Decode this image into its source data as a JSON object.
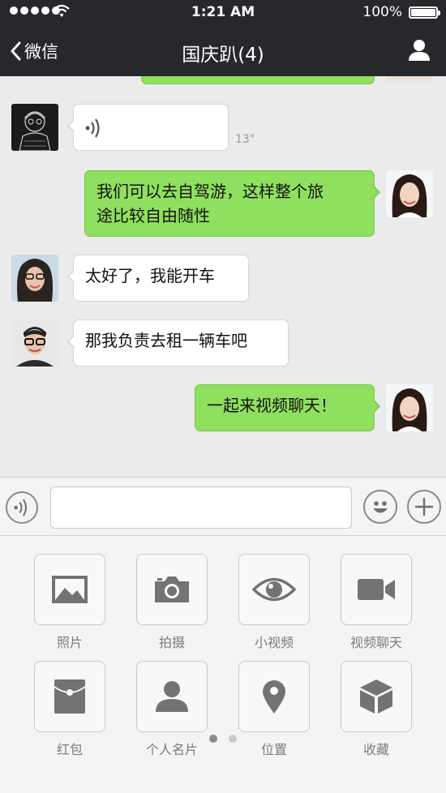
{
  "status_bar": {
    "time": "1:21 AM",
    "battery": "100%"
  },
  "nav": {
    "back_label": "微信",
    "title": "国庆趴(4)"
  },
  "messages": [
    {
      "side": "left",
      "type": "voice",
      "duration": "13\""
    },
    {
      "side": "right",
      "type": "text",
      "text_line1": "我们可以去自驾游，这样整个旅",
      "text_line2": "途比较自由随性"
    },
    {
      "side": "left",
      "type": "text",
      "text": "太好了，我能开车"
    },
    {
      "side": "left",
      "type": "text",
      "text": "那我负责去租一辆车吧"
    },
    {
      "side": "right",
      "type": "text",
      "text": "一起来视频聊天！"
    }
  ],
  "panel": {
    "items": [
      {
        "label": "照片",
        "icon": "photo-icon"
      },
      {
        "label": "拍摄",
        "icon": "camera-icon"
      },
      {
        "label": "小视频",
        "icon": "eye-icon"
      },
      {
        "label": "视频聊天",
        "icon": "video-camera-icon"
      },
      {
        "label": "红包",
        "icon": "red-envelope-icon"
      },
      {
        "label": "个人名片",
        "icon": "person-icon"
      },
      {
        "label": "位置",
        "icon": "location-pin-icon"
      },
      {
        "label": "收藏",
        "icon": "box-icon"
      }
    ],
    "page_count": 2,
    "active_page": 1
  },
  "colors": {
    "nav_bg": "#26282c",
    "bubble_green": "#8fe05e",
    "chat_bg": "#ebebeb",
    "icon_gray": "#737373"
  }
}
